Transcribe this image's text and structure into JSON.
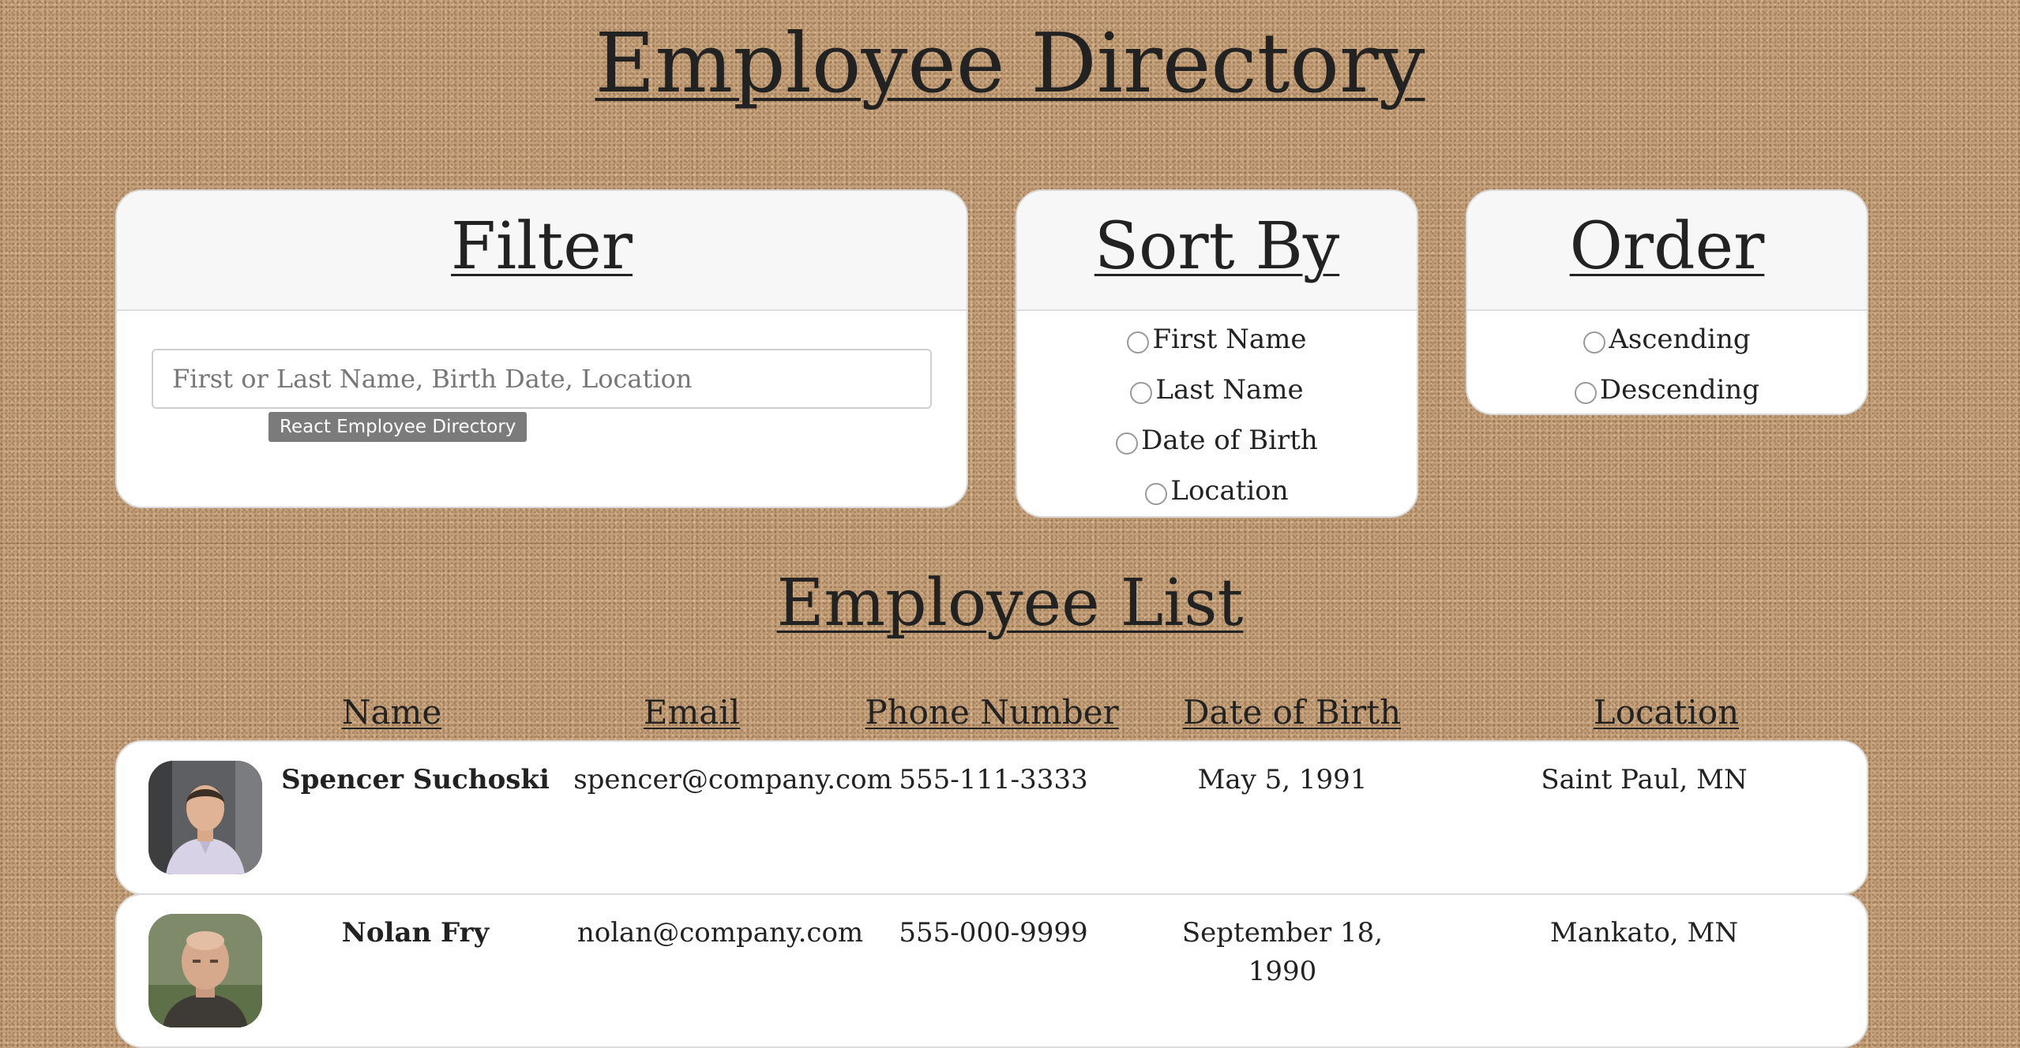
{
  "header": {
    "title": "Employee Directory"
  },
  "filter": {
    "title": "Filter",
    "placeholder": "First or Last Name, Birth Date, Location",
    "tooltip": "React Employee Directory"
  },
  "sort": {
    "title": "Sort By",
    "options": [
      "First Name",
      "Last Name",
      "Date of Birth",
      "Location"
    ]
  },
  "order": {
    "title": "Order",
    "options": [
      "Ascending",
      "Descending"
    ]
  },
  "list": {
    "title": "Employee List",
    "columns": [
      "Name",
      "Email",
      "Phone Number",
      "Date of Birth",
      "Location"
    ],
    "employees": [
      {
        "name": "Spencer Suchoski",
        "email": "spencer@company.com",
        "phone": "555-111-3333",
        "dob": "May 5, 1991",
        "location": "Saint Paul, MN"
      },
      {
        "name": "Nolan Fry",
        "email": "nolan@company.com",
        "phone": "555-000-9999",
        "dob": "September 18, 1990",
        "location": "Mankato, MN"
      }
    ]
  }
}
